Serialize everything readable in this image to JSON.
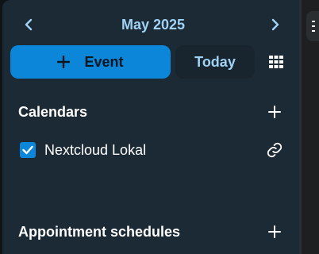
{
  "header": {
    "month_label": "May 2025",
    "prev_icon": "chevron-left-icon",
    "next_icon": "chevron-right-icon"
  },
  "actions": {
    "new_event_label": "Event",
    "today_label": "Today",
    "view_icon": "grid-icon"
  },
  "calendars": {
    "title": "Calendars",
    "items": [
      {
        "name": "Nextcloud Lokal",
        "checked": true,
        "share_icon": "link-icon"
      }
    ]
  },
  "appointments": {
    "title": "Appointment schedules"
  },
  "colors": {
    "accent": "#0b86d9",
    "accent_text": "#9fd2f5",
    "sidebar_bg": "#1b2a35",
    "text": "#ffffff"
  }
}
